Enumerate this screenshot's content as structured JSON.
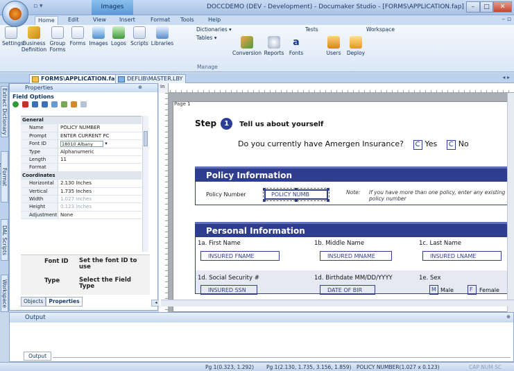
{
  "titlebar": {
    "context_tab": "Images",
    "window_title": "DOCCDEMO (DEV - Development) - Documaker Studio - [FORMS\\APPLICATION.fap]",
    "min_icon": "minimize-icon",
    "max_icon": "maximize-icon",
    "close_icon": "close-icon"
  },
  "ribbon_tabs": [
    "Home",
    "Edit",
    "View",
    "Insert",
    "Format",
    "Tools",
    "Help"
  ],
  "ribbon_buttons": [
    {
      "l1": "Settings",
      "l2": ""
    },
    {
      "l1": "Business",
      "l2": "Definition"
    },
    {
      "l1": "Group",
      "l2": "Forms"
    },
    {
      "l1": "Forms",
      "l2": ""
    },
    {
      "l1": "Images",
      "l2": ""
    },
    {
      "l1": "Logos",
      "l2": ""
    },
    {
      "l1": "Scripts",
      "l2": ""
    },
    {
      "l1": "Libraries",
      "l2": ""
    }
  ],
  "ribbon_small": {
    "dictionaries": "Dictionaries",
    "tables": "Tables",
    "tests": "Tests",
    "workspace": "Workspace"
  },
  "ribbon_buttons2": [
    {
      "l1": "Conversion",
      "l2": ""
    },
    {
      "l1": "Reports",
      "l2": ""
    },
    {
      "l1": "Fonts",
      "l2": ""
    },
    {
      "l1": "Users",
      "l2": ""
    },
    {
      "l1": "Deploy",
      "l2": ""
    }
  ],
  "ribbon_group_label": "Manage",
  "doc_tabs": [
    "FORMS\\APPLICATION.fap",
    "DEFLIB\\MASTER.LBY"
  ],
  "side_tabs": [
    "Extract Dictionary",
    "Format Navigation",
    "DAL Scripts",
    "Workspace"
  ],
  "properties": {
    "title": "Properties",
    "section": "Field Options",
    "rows": [
      {
        "k": "General",
        "v": "",
        "cat": true
      },
      {
        "k": "Name",
        "v": "POLICY NUMBER"
      },
      {
        "k": "Prompt",
        "v": "ENTER CURRENT PC"
      },
      {
        "k": "Font ID",
        "v": "18010 Albany",
        "select": true
      },
      {
        "k": "Type",
        "v": "Alphanumeric"
      },
      {
        "k": "Length",
        "v": "11"
      },
      {
        "k": "Format",
        "v": ""
      },
      {
        "k": "Coordinates",
        "v": "",
        "cat": true
      },
      {
        "k": "Horizontal",
        "v": "2.130 Inches"
      },
      {
        "k": "Vertical",
        "v": "1.735 Inches"
      },
      {
        "k": "Width",
        "v": "1.027 Inches",
        "dim": true
      },
      {
        "k": "Height",
        "v": "0.123 Inches",
        "dim": true
      },
      {
        "k": "Adjustment",
        "v": "None"
      }
    ],
    "help": [
      {
        "k": "Font ID",
        "v": "Set the font ID to use"
      },
      {
        "k": "Type",
        "v": "Select the Field Type"
      }
    ],
    "bottom_tabs": [
      "Objects",
      "Properties"
    ]
  },
  "canvas": {
    "ruler_unit": "In",
    "page_label": "Page 1",
    "step_word": "Step",
    "step_num": "1",
    "step_title": "Tell us about yourself",
    "question": "Do you currently have Amergen Insurance?",
    "yes_mark": "C",
    "yes": "Yes",
    "no_mark": "C",
    "no": "No",
    "policy_band": "Policy Information",
    "policy_label": "Policy Number",
    "policy_field": "POLICY NUMB",
    "note_label": "Note:",
    "note_text": "If you have more than one policy, enter any existing policy number",
    "personal_band": "Personal Information",
    "f1a_label": "1a. First Name",
    "f1a_box": "INSURED FNAME",
    "f1b_label": "1b. Middle Name",
    "f1b_box": "INSURED MNAME",
    "f1c_label": "1c. Last Name",
    "f1c_box": "INSURED LNAME",
    "f1d_label": "1d. Social Security #",
    "f1d_box": "INSURED SSN",
    "f1dd_label": "1d. Birthdate MM/DD/YYYY",
    "f1dd_box": "DATE OF BIR",
    "f1e_label": "1e. Sex",
    "male_mark": "M",
    "male": "Male",
    "female_mark": "F",
    "female": "Female"
  },
  "output": {
    "title": "Output",
    "tab": "Output"
  },
  "status": {
    "pos1": "Pg 1(0.323, 1.292)",
    "pos2": "Pg 1(2.130, 1.735, 3.156, 1.859)",
    "field": "POLICY NUMBER(1.027 x 0.123)",
    "keys": "CAP  NUM  SC"
  }
}
